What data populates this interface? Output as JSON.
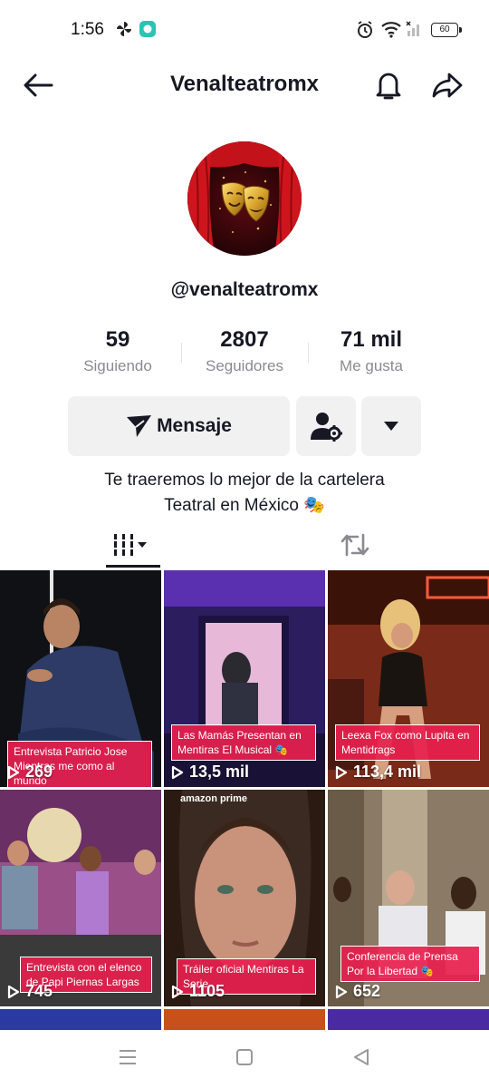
{
  "status_bar": {
    "time": "1:56",
    "battery": "60"
  },
  "header": {
    "title": "Venalteatromx"
  },
  "profile": {
    "handle": "@venalteatromx"
  },
  "stats": [
    {
      "value": "59",
      "label": "Siguiendo"
    },
    {
      "value": "2807",
      "label": "Seguidores"
    },
    {
      "value": "71 mil",
      "label": "Me gusta"
    }
  ],
  "actions": {
    "message_label": "Mensaje"
  },
  "bio": {
    "line1": "Te traeremos lo mejor de la cartelera",
    "line2": "Teatral en México 🎭"
  },
  "videos": [
    {
      "caption": "Entrevista Patricio Jose Mientras me como al mundo",
      "views": "269"
    },
    {
      "caption": "Las Mamás Presentan en Mentiras El Musical 🎭",
      "views": "13,5 mil"
    },
    {
      "caption": "Leexa Fox como Lupita en Mentidrags",
      "views": "113,4 mil"
    },
    {
      "caption": "Entrevista con el elenco de Papi Piernas Largas",
      "views": "745"
    },
    {
      "caption": "Tráiler oficial Mentiras La Serie",
      "views": "1105",
      "badge": "amazon prime"
    },
    {
      "caption": "Conferencia de Prensa Por la Libertad 🎭",
      "views": "652"
    }
  ],
  "colors": {
    "accent": "#e8204e",
    "text": "#161823",
    "muted": "#8a8b91",
    "button_bg": "#f1f1f2"
  }
}
